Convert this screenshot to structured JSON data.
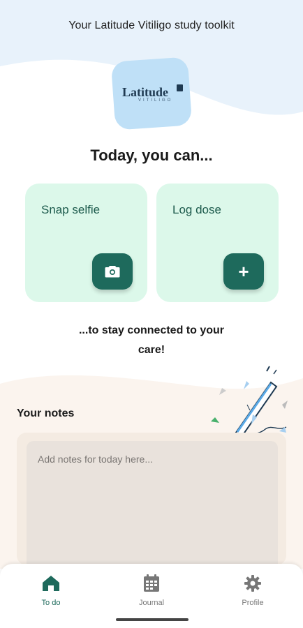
{
  "header": {
    "title": "Your Latitude Vitiligo study toolkit"
  },
  "logo": {
    "word": "Latitude",
    "sub": "VITILIGO"
  },
  "today": {
    "heading": "Today, you can...",
    "actions": [
      {
        "label": "Snap selfie",
        "icon": "camera-icon"
      },
      {
        "label": "Log dose",
        "icon": "plus-icon"
      }
    ],
    "tagline": "...to stay connected to your care!"
  },
  "notes": {
    "heading": "Your notes",
    "placeholder": "Add notes for today here...",
    "value": ""
  },
  "nav": {
    "items": [
      {
        "label": "To do",
        "icon": "home-icon",
        "active": true
      },
      {
        "label": "Journal",
        "icon": "calendar-icon",
        "active": false
      },
      {
        "label": "Profile",
        "icon": "gear-icon",
        "active": false
      }
    ]
  },
  "colors": {
    "accent": "#1e6a5c",
    "card": "#dcf8ea",
    "header_bg": "#e8f2fb",
    "notes_bg": "#fbf4ee"
  }
}
